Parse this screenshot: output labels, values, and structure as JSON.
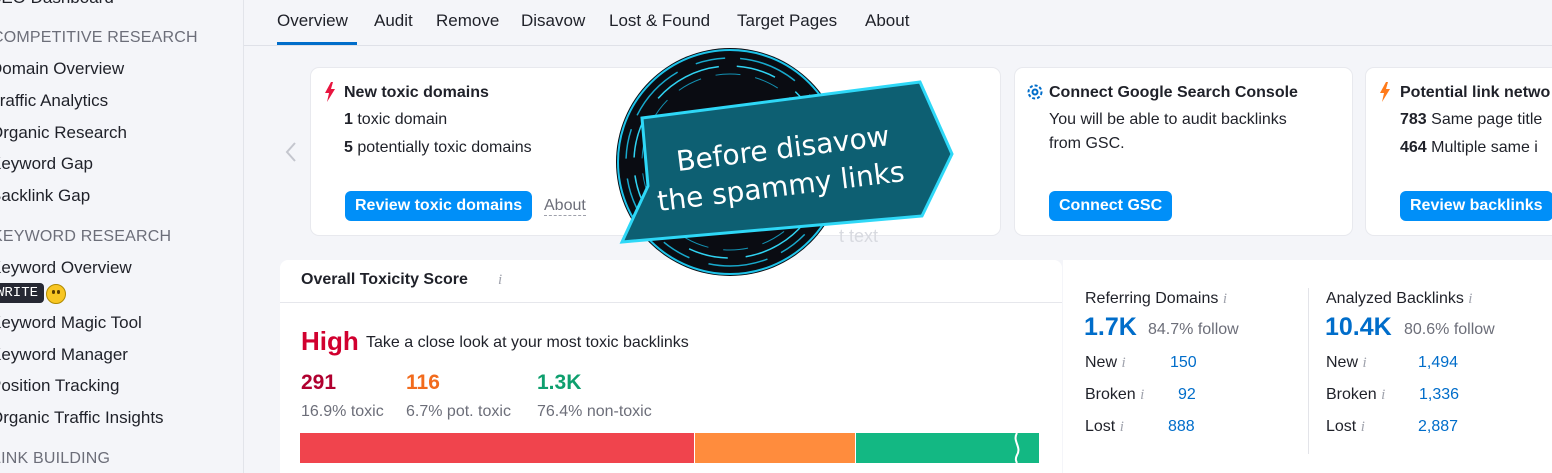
{
  "sidebar": {
    "top_item": "SEO Dashboard",
    "section_competitive": "COMPETITIVE RESEARCH",
    "competitive_items": [
      "Domain Overview",
      "Traffic Analytics",
      "Organic Research",
      "Keyword Gap",
      "Backlink Gap"
    ],
    "section_keyword": "KEYWORD RESEARCH",
    "keyword_overview": "Keyword Overview",
    "badge": "WRITE",
    "keyword_items": [
      "Keyword Magic Tool",
      "Keyword Manager",
      "Position Tracking",
      "Organic Traffic Insights"
    ],
    "section_link": "LINK BUILDING"
  },
  "tabs": [
    "Overview",
    "Audit",
    "Remove",
    "Disavow",
    "Lost & Found",
    "Target Pages",
    "About"
  ],
  "cards": {
    "toxic": {
      "title": "New toxic domains",
      "line1_num": "1",
      "line1_text": " toxic domain",
      "line2_num": "5",
      "line2_text": " potentially toxic domains",
      "button": "Review toxic domains",
      "about": "About"
    },
    "gsc": {
      "title": "Connect Google Search Console",
      "line1": "You will be able to audit backlinks",
      "line2": "from GSC.",
      "button": "Connect GSC"
    },
    "network": {
      "title": "Potential link netwo",
      "line1_num": "783",
      "line1_text": " Same page title",
      "line2_num": "464",
      "line2_text": " Multiple same i",
      "button": "Review backlinks"
    },
    "ghost_text": "t text"
  },
  "overlay": {
    "line1": "Before disavow",
    "line2": "the spammy links"
  },
  "toxicity": {
    "title": "Overall Toxicity Score",
    "level": "High",
    "message": "Take a close look at your most toxic backlinks",
    "toxic_count": "291",
    "toxic_pct": "16.9% toxic",
    "pot_count": "116",
    "pot_pct": "6.7% pot. toxic",
    "non_count": "1.3K",
    "non_pct": "76.4% non-toxic",
    "bar_fractions": [
      0.169,
      0.067,
      0.764
    ],
    "colors": {
      "toxic": "#f0444d",
      "pot": "#ff8c3d",
      "non": "#13b883",
      "high": "#d1002f"
    }
  },
  "referring": {
    "label": "Referring Domains",
    "value": "1.7K",
    "follow": "84.7% follow",
    "rows": [
      {
        "label": "New",
        "value": "150"
      },
      {
        "label": "Broken",
        "value": "92"
      },
      {
        "label": "Lost",
        "value": "888"
      }
    ]
  },
  "backlinks": {
    "label": "Analyzed Backlinks",
    "value": "10.4K",
    "follow": "80.6% follow",
    "rows": [
      {
        "label": "New",
        "value": "1,494"
      },
      {
        "label": "Broken",
        "value": "1,336"
      },
      {
        "label": "Lost",
        "value": "2,887"
      }
    ]
  },
  "info_glyph": "i"
}
